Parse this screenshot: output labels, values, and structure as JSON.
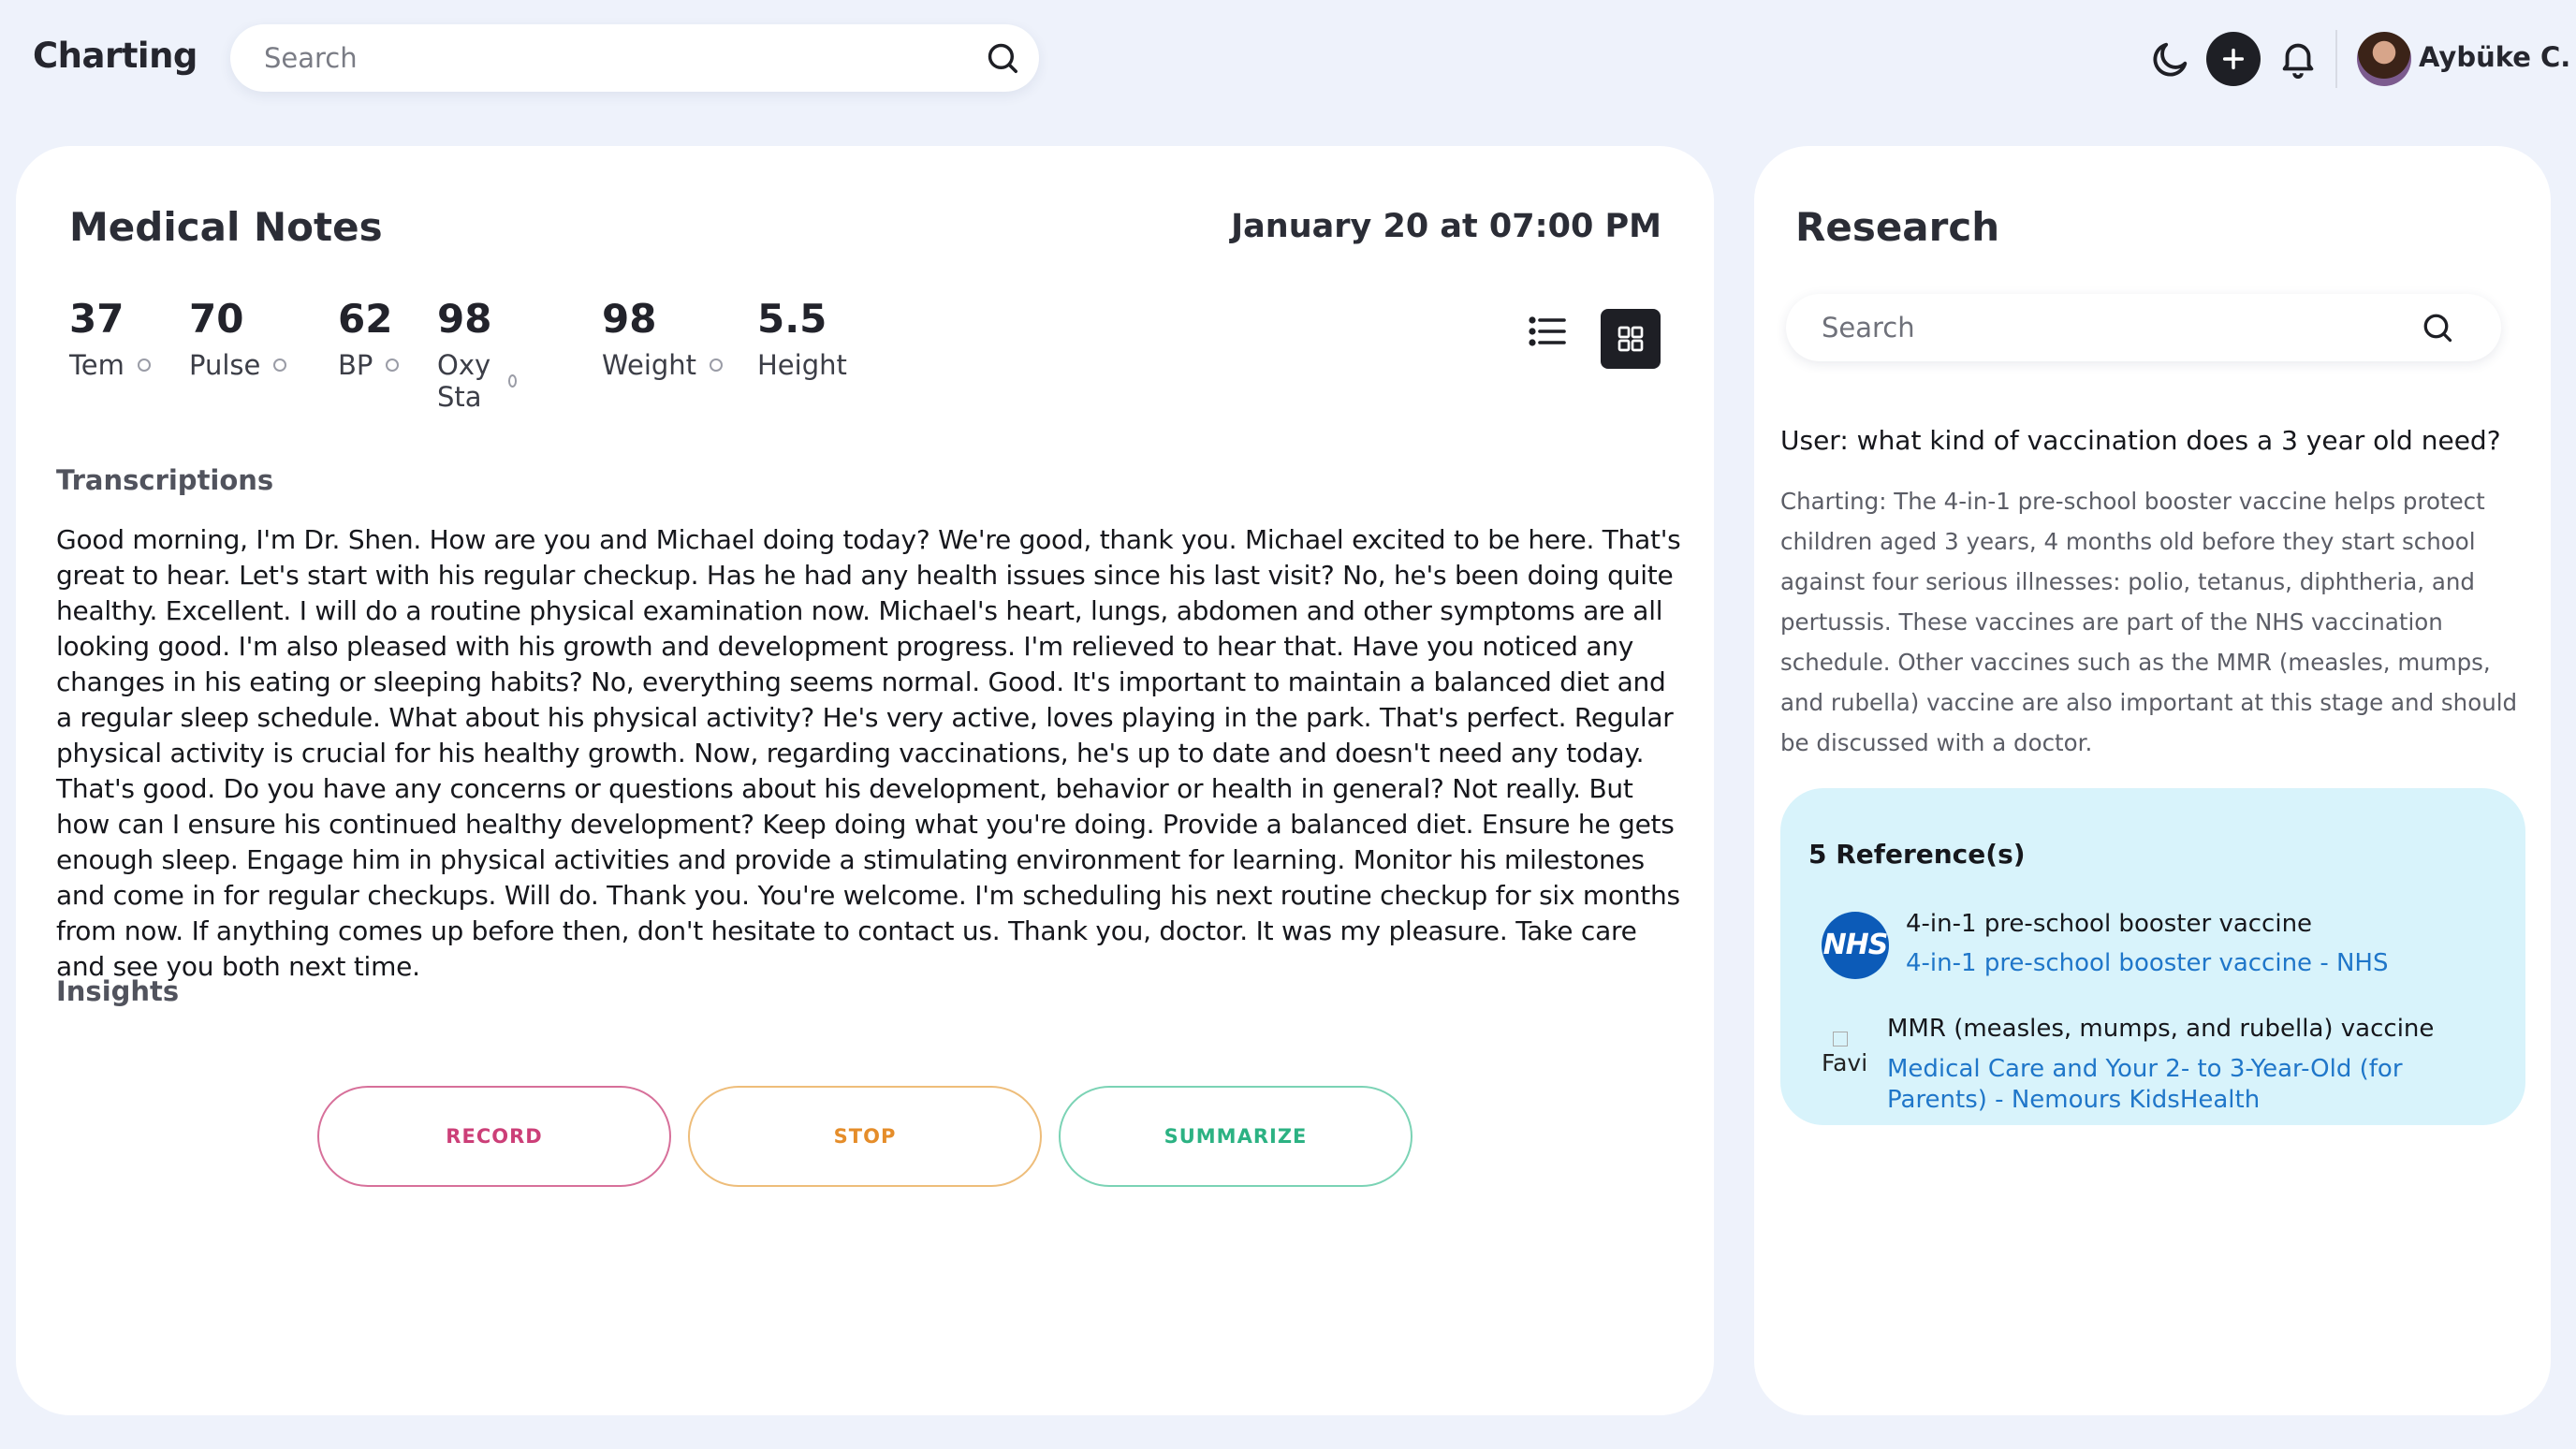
{
  "header": {
    "brand": "Charting",
    "search_placeholder": "Search",
    "user_name": "Aybüke C."
  },
  "notes": {
    "title": "Medical Notes",
    "date": "January 20 at 07:00 PM",
    "vitals": [
      {
        "value": "37",
        "label": "Tem",
        "indicator": true
      },
      {
        "value": "70",
        "label": "Pulse",
        "indicator": true
      },
      {
        "value": "62",
        "label": "BP",
        "indicator": true
      },
      {
        "value": "98",
        "label": "Oxy Sta",
        "indicator": true
      },
      {
        "value": "98",
        "label": "Weight",
        "indicator": true
      },
      {
        "value": "5.5",
        "label": "Height",
        "indicator": false
      }
    ],
    "transcriptions_heading": "Transcriptions",
    "transcription": "Good morning, I'm Dr. Shen. How are you and Michael doing today? We're good, thank you. Michael excited to be here. That's great to hear. Let's start with his regular checkup. Has he had any health issues since his last visit? No, he's been doing quite healthy. Excellent. I will do a routine physical examination now. Michael's heart, lungs, abdomen and other symptoms are all looking good. I'm also pleased with his growth and development progress. I'm relieved to hear that. Have you noticed any changes in his eating or sleeping habits? No, everything seems normal. Good. It's important to maintain a balanced diet and a regular sleep schedule. What about his physical activity? He's very active, loves playing in the park. That's perfect. Regular physical activity is crucial for his healthy growth. Now, regarding vaccinations, he's up to date and doesn't need any today. That's good. Do you have any concerns or questions about his development, behavior or health in general? Not really. But how can I ensure his continued healthy development? Keep doing what you're doing. Provide a balanced diet. Ensure he gets enough sleep. Engage him in physical activities and provide a stimulating environment for learning. Monitor his milestones and come in for regular checkups. Will do. Thank you. You're welcome. I'm scheduling his next routine checkup for six months from now. If anything comes up before then, don't hesitate to contact us. Thank you, doctor. It was my pleasure. Take care and see you both next time.",
    "insights_heading": "Insights",
    "buttons": {
      "record": "RECORD",
      "stop": "STOP",
      "summarize": "SUMMARIZE"
    }
  },
  "research": {
    "title": "Research",
    "search_placeholder": "Search",
    "user_question": "User: what kind of vaccination does a 3 year old need?",
    "answer": "Charting: The 4-in-1 pre-school booster vaccine helps protect children aged 3 years, 4 months old before they start school against four serious illnesses: polio, tetanus, diphtheria, and pertussis. These vaccines are part of the NHS vaccination schedule. Other vaccines such as the MMR (measles, mumps, and rubella) vaccine are also important at this stage and should be discussed with a doctor.",
    "references_heading": "5 Reference(s)",
    "references": [
      {
        "logo_text": "NHS",
        "title": "4-in-1 pre-school booster vaccine",
        "link": "4-in-1 pre-school booster vaccine - NHS"
      },
      {
        "logo_text": "Favi",
        "title": "MMR (measles, mumps, and rubella) vaccine",
        "link": "Medical Care and Your 2- to 3-Year-Old (for Parents) - Nemours KidsHealth"
      }
    ]
  },
  "colors": {
    "background": "#eef2fb",
    "record": "#cc3f78",
    "stop": "#e58d2a",
    "summarize": "#2cb283",
    "reference_panel": "#d8f3fb",
    "link": "#1f76c9"
  }
}
